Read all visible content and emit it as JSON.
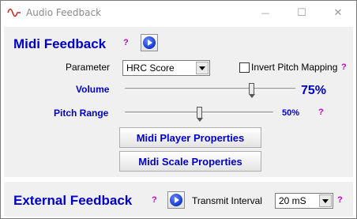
{
  "window": {
    "title": "Audio Feedback",
    "minimize_glyph": "—",
    "maximize_glyph": "☐",
    "close_glyph": "✕"
  },
  "midi_feedback": {
    "heading": "Midi Feedback",
    "help": "?",
    "parameter_label": "Parameter",
    "parameter_value": "HRC Score",
    "invert_label": "Invert Pitch Mapping",
    "invert_checked": false,
    "invert_help": "?",
    "volume_label": "Volume",
    "volume_value": "75%",
    "volume_fraction": 0.75,
    "pitch_range_label": "Pitch Range",
    "pitch_range_value": "50%",
    "pitch_range_fraction": 0.5,
    "pitch_help": "?",
    "player_button": "Midi Player Properties",
    "scale_button": "Midi Scale Properties"
  },
  "external_feedback": {
    "heading": "External Feedback",
    "help": "?",
    "transmit_label": "Transmit Interval",
    "transmit_value": "20 mS",
    "transmit_help": "?"
  },
  "colors": {
    "heading_blue": "#0000cc",
    "help_magenta": "#cc00cc",
    "panel_gray": "#f0f0f0"
  },
  "icons": {
    "app": "waveform-icon",
    "play": "play-icon"
  }
}
